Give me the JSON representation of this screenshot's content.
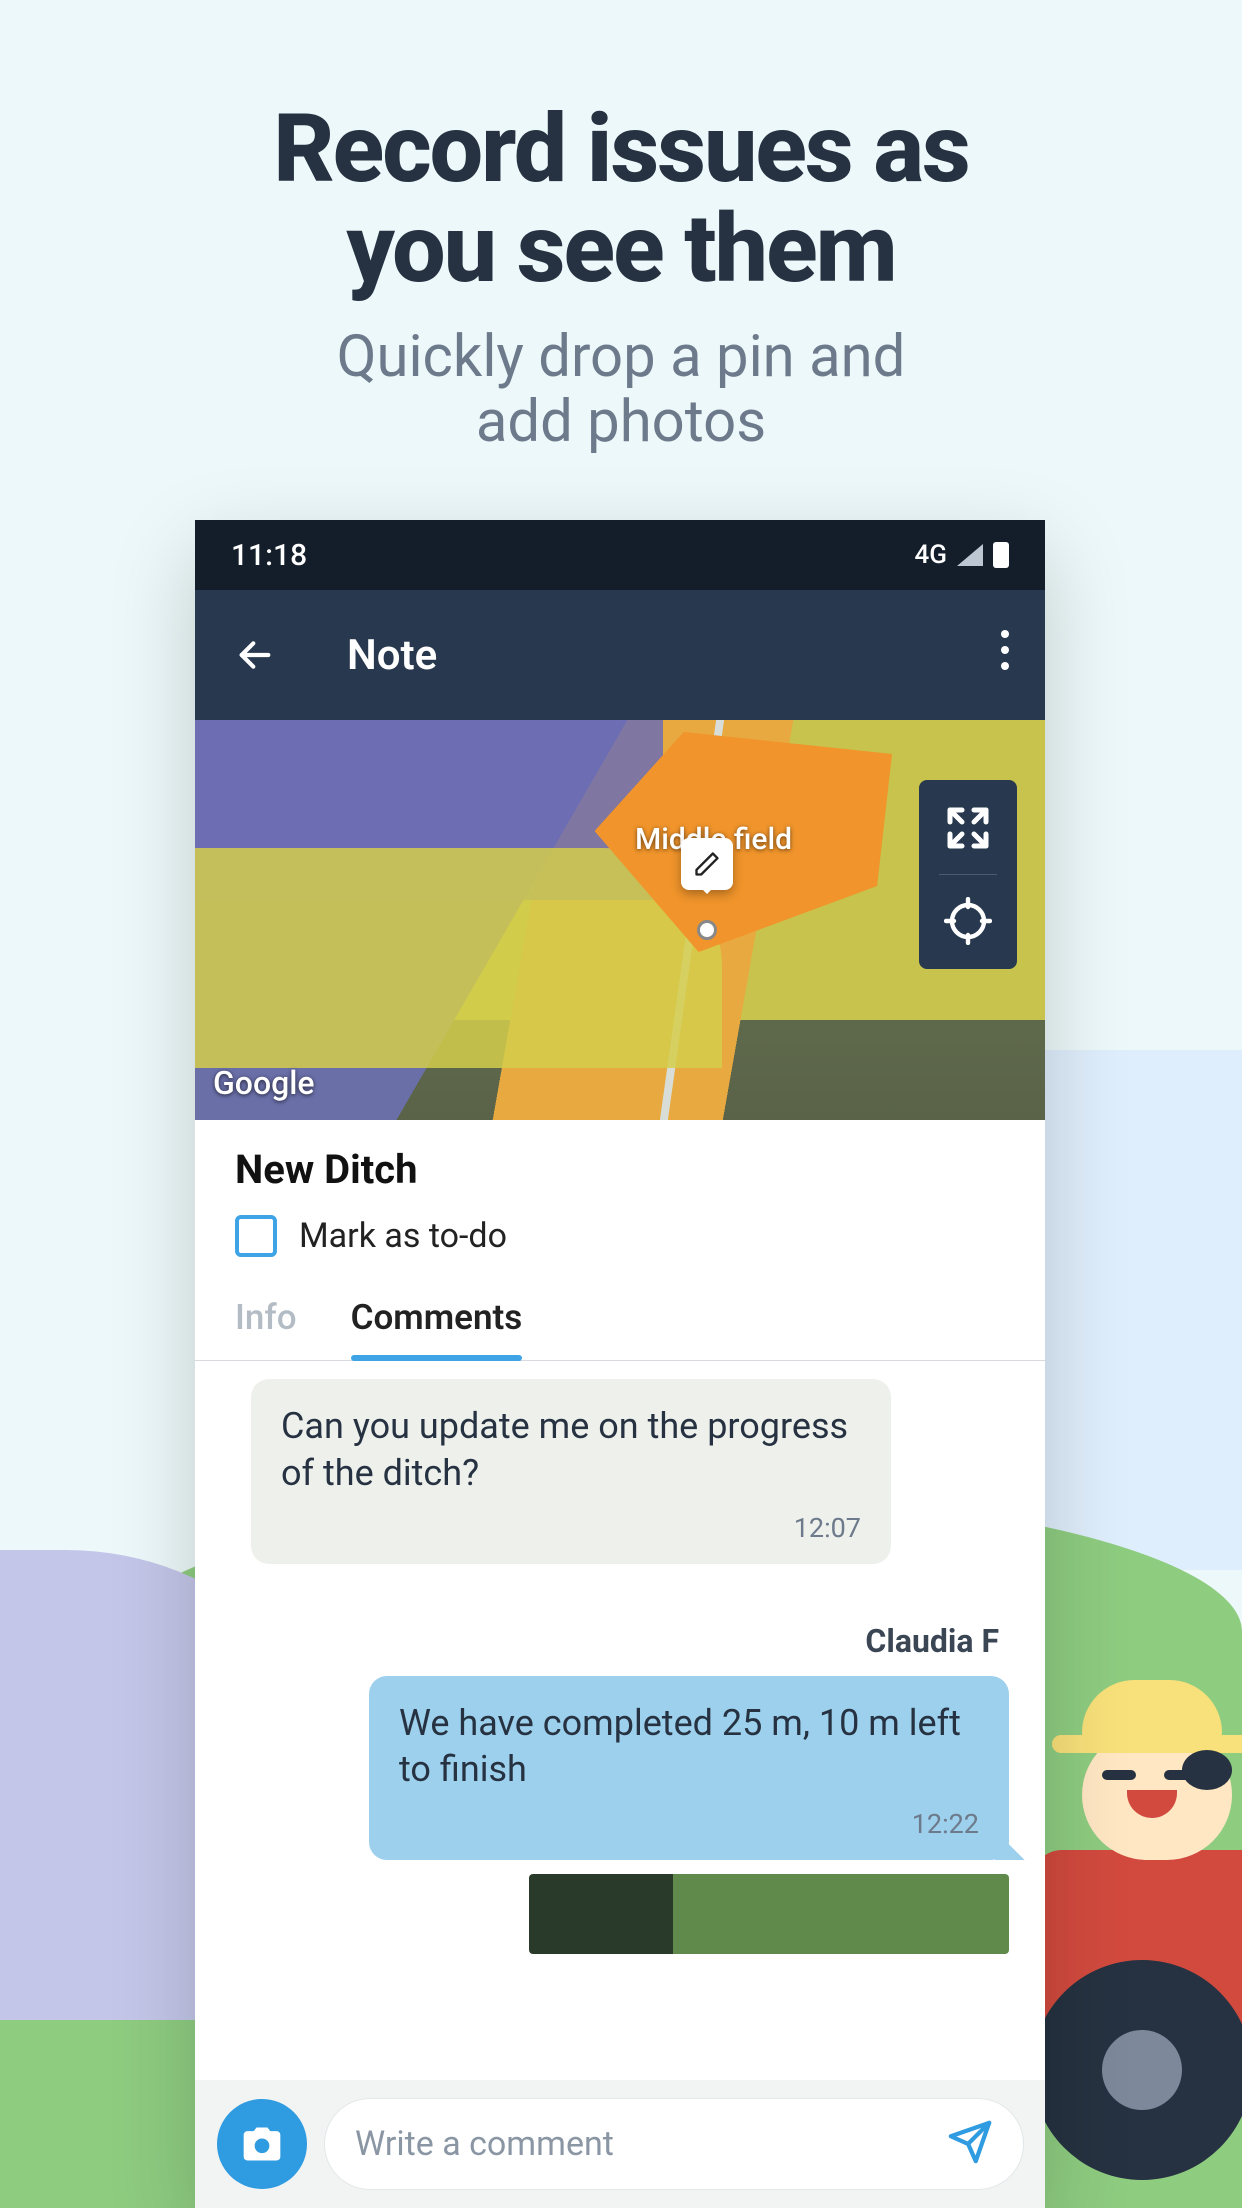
{
  "promo": {
    "title_line1": "Record issues as",
    "title_line2": "you see them",
    "subtitle_line1": "Quickly drop a pin and",
    "subtitle_line2": "add photos"
  },
  "status": {
    "time": "11:18",
    "network": "4G"
  },
  "appbar": {
    "title": "Note"
  },
  "map": {
    "field_label": "Middle field",
    "provider": "Google"
  },
  "note": {
    "title": "New Ditch",
    "todo_label": "Mark as to-do"
  },
  "tabs": {
    "info": "Info",
    "comments": "Comments"
  },
  "thread": {
    "msg1": {
      "text": "Can you update me on the progress of the ditch?",
      "time": "12:07"
    },
    "sender2": "Claudia F",
    "msg2": {
      "text": "We have completed 25 m, 10 m left to finish",
      "time": "12:22"
    }
  },
  "composer": {
    "placeholder": "Write a comment"
  }
}
